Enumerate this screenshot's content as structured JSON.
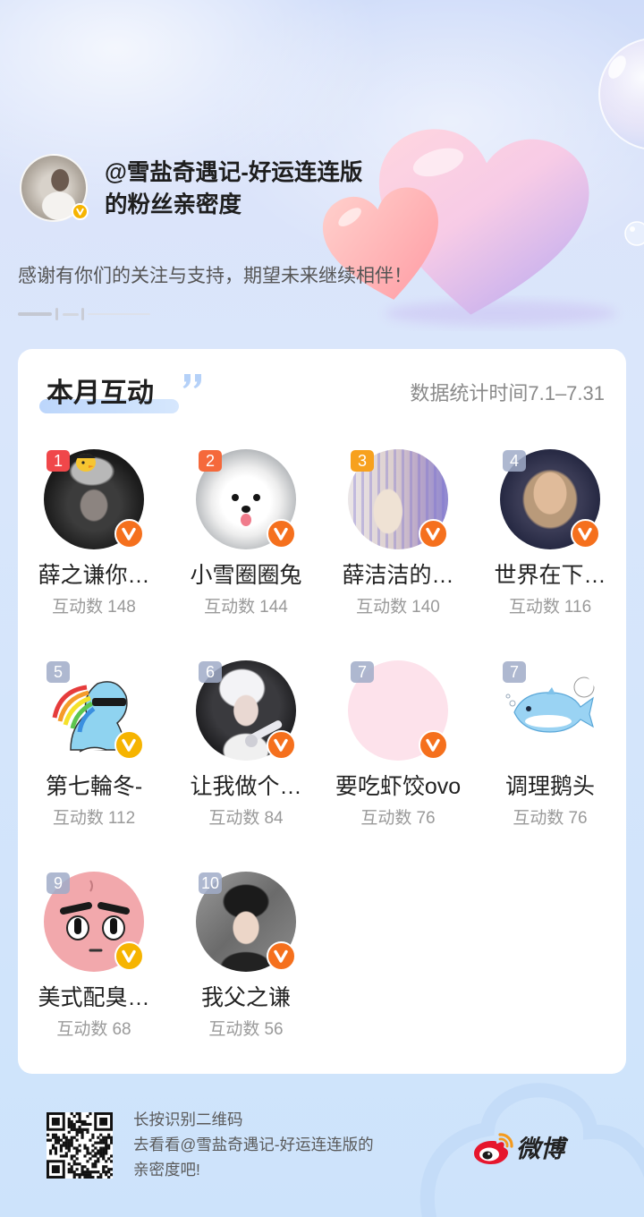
{
  "header": {
    "title_line1": "@雪盐奇遇记-好运连连版",
    "title_line2": "的粉丝亲密度",
    "subtitle": "感谢有你们的关注与支持，期望未来继续相伴！",
    "avatar_verified": "gold"
  },
  "card": {
    "title": "本月互动",
    "stats_period": "数据统计时间7.1–7.31",
    "interaction_label": "互动数",
    "fans": [
      {
        "rank": "1",
        "name": "薛之谦你…",
        "count": 148,
        "verified": "orange"
      },
      {
        "rank": "2",
        "name": "小雪圈圈兔",
        "count": 144,
        "verified": "orange"
      },
      {
        "rank": "3",
        "name": "薛洁洁的…",
        "count": 140,
        "verified": "orange"
      },
      {
        "rank": "4",
        "name": "世界在下…",
        "count": 116,
        "verified": "orange"
      },
      {
        "rank": "5",
        "name": "第七輪冬-",
        "count": 112,
        "verified": "gold"
      },
      {
        "rank": "6",
        "name": "让我做个…",
        "count": 84,
        "verified": "orange"
      },
      {
        "rank": "7",
        "name": "要吃虾饺ovo",
        "count": 76,
        "verified": "orange"
      },
      {
        "rank": "7",
        "name": "调理鹅头",
        "count": 76,
        "verified": "none"
      },
      {
        "rank": "9",
        "name": "美式配臭…",
        "count": 68,
        "verified": "gold"
      },
      {
        "rank": "10",
        "name": "我父之谦",
        "count": 56,
        "verified": "orange"
      }
    ]
  },
  "footer": {
    "qr_hint": "长按识别二维码",
    "cta_line1": "去看看@雪盐奇遇记-好运连连版的",
    "cta_line2": "亲密度吧!",
    "brand_name": "微博"
  },
  "icons": {
    "verified_badge": "verified-v-icon",
    "quote": "quote-mark-icon",
    "brand_logo": "weibo-logo-icon",
    "qr": "qr-code",
    "hearts": "hearts-decoration"
  },
  "colors": {
    "rank_1": "#f0474a",
    "rank_2": "#f5693b",
    "rank_3": "#f7a11e",
    "rank_other": "#a0abc8",
    "verified_orange": "#f5701d",
    "verified_gold": "#f6b400",
    "brand_red": "#e6162d",
    "title_highlight": "#bcd6fb"
  }
}
